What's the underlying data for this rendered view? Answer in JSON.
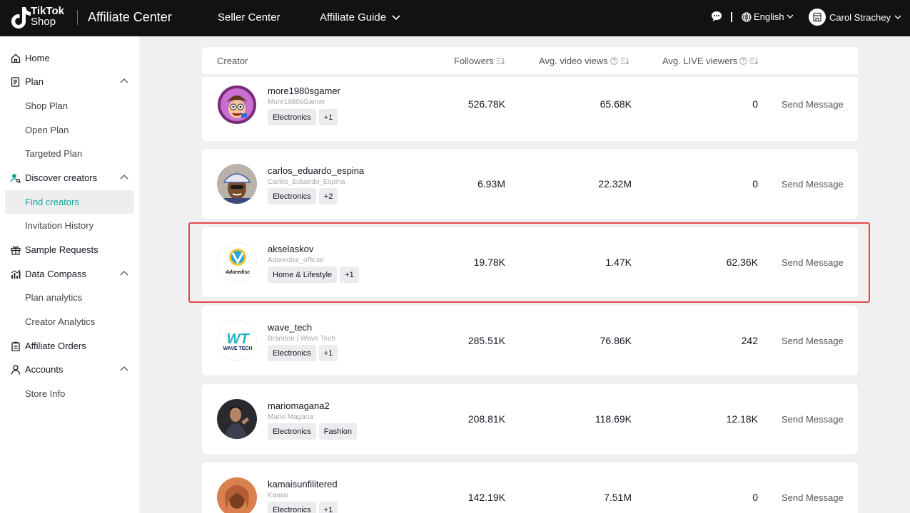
{
  "topbar": {
    "logo_top": "TikTok",
    "logo_bottom": "Shop",
    "app_name": "Affiliate Center",
    "nav_seller": "Seller Center",
    "nav_guide": "Affiliate Guide",
    "language": "English",
    "user_name": "Carol Strachey"
  },
  "sidebar": {
    "items": [
      {
        "label": "Home"
      },
      {
        "label": "Plan"
      },
      {
        "label": "Shop Plan"
      },
      {
        "label": "Open Plan"
      },
      {
        "label": "Targeted Plan"
      },
      {
        "label": "Discover creators"
      },
      {
        "label": "Find creators"
      },
      {
        "label": "Invitation History"
      },
      {
        "label": "Sample Requests"
      },
      {
        "label": "Data Compass"
      },
      {
        "label": "Plan analytics"
      },
      {
        "label": "Creator Analytics"
      },
      {
        "label": "Affiliate Orders"
      },
      {
        "label": "Accounts"
      },
      {
        "label": "Store Info"
      }
    ]
  },
  "table": {
    "headers": {
      "creator": "Creator",
      "followers": "Followers",
      "video_views": "Avg. video views",
      "live_viewers": "Avg. LIVE viewers"
    },
    "rows": [
      {
        "username": "more1980sgamer",
        "nickname": "More1980sGamer",
        "tag1": "Electronics",
        "tag2": "+1",
        "followers": "526.78K",
        "video_views": "65.68K",
        "live_viewers": "0",
        "action": "Send Message"
      },
      {
        "username": "carlos_eduardo_espina",
        "nickname": "Carlos_Eduardo_Espina",
        "tag1": "Electronics",
        "tag2": "+2",
        "followers": "6.93M",
        "video_views": "22.32M",
        "live_viewers": "0",
        "action": "Send Message"
      },
      {
        "username": "akselaskov",
        "nickname": "Adoredisc_official",
        "tag1": "Home & Lifestyle",
        "tag2": "+1",
        "followers": "19.78K",
        "video_views": "1.47K",
        "live_viewers": "62.36K",
        "action": "Send Message",
        "avatar_text": "Adoredisc"
      },
      {
        "username": "wave_tech",
        "nickname": "Brandon | Wave Tech",
        "tag1": "Electronics",
        "tag2": "+1",
        "followers": "285.51K",
        "video_views": "76.86K",
        "live_viewers": "242",
        "action": "Send Message",
        "avatar_text": "WAVE TECH"
      },
      {
        "username": "mariomagana2",
        "nickname": "Mario Magana",
        "tag1": "Electronics",
        "tag2": "Fashion",
        "followers": "208.81K",
        "video_views": "118.69K",
        "live_viewers": "12.18K",
        "action": "Send Message"
      },
      {
        "username": "kamaisunfilitered",
        "nickname": "Kamai",
        "tag1": "Electronics",
        "tag2": "+1",
        "followers": "142.19K",
        "video_views": "7.51M",
        "live_viewers": "0",
        "action": "Send Message"
      }
    ]
  },
  "colors": {
    "accent": "#14a4a0",
    "highlight": "#e4484a",
    "topbar": "#121212"
  }
}
